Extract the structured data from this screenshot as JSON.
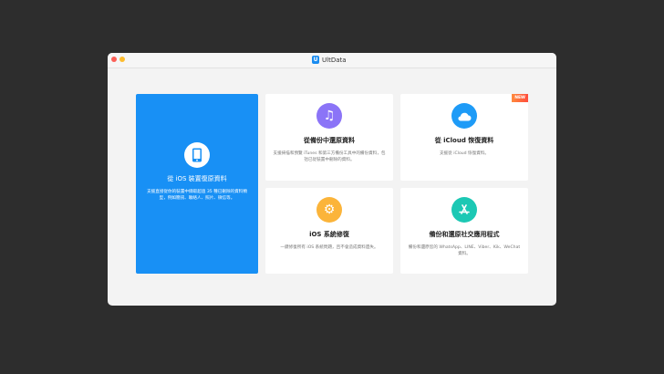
{
  "window": {
    "title": "UltData",
    "logo_letter": "U"
  },
  "cards": [
    {
      "title": "從 iOS 裝置復原資料",
      "desc": "支援直接從你的裝置中擷取超過 35 種已刪除的資料類型，例如簡訊、聯絡人、照片、微信等。",
      "icon": "phone-icon",
      "color": "#1890f5"
    },
    {
      "title": "從備份中還原資料",
      "desc": "支援掃描和預覽 iTunes 和第三方備份工具中的備份資料，包括已從裝置中刪除的資料。",
      "icon": "music-note-icon",
      "color": "#8b74f7"
    },
    {
      "title": "從 iCloud 恢復資料",
      "desc": "支援從 iCloud 恢復資料。",
      "icon": "cloud-icon",
      "color": "#1e9bf7",
      "badge": "NEW"
    },
    {
      "title": "iOS 系統修復",
      "desc": "一鍵修復所有 iOS 系統問題，且不會造成資料遺失。",
      "icon": "gear-icon",
      "color": "#fbb43a"
    },
    {
      "title": "備份和還原社交應用程式",
      "desc": "備份和還原您的 WhatsApp、LINE、Viber、Kik、WeChat 資料。",
      "icon": "app-store-icon",
      "color": "#1cc8b4"
    }
  ]
}
